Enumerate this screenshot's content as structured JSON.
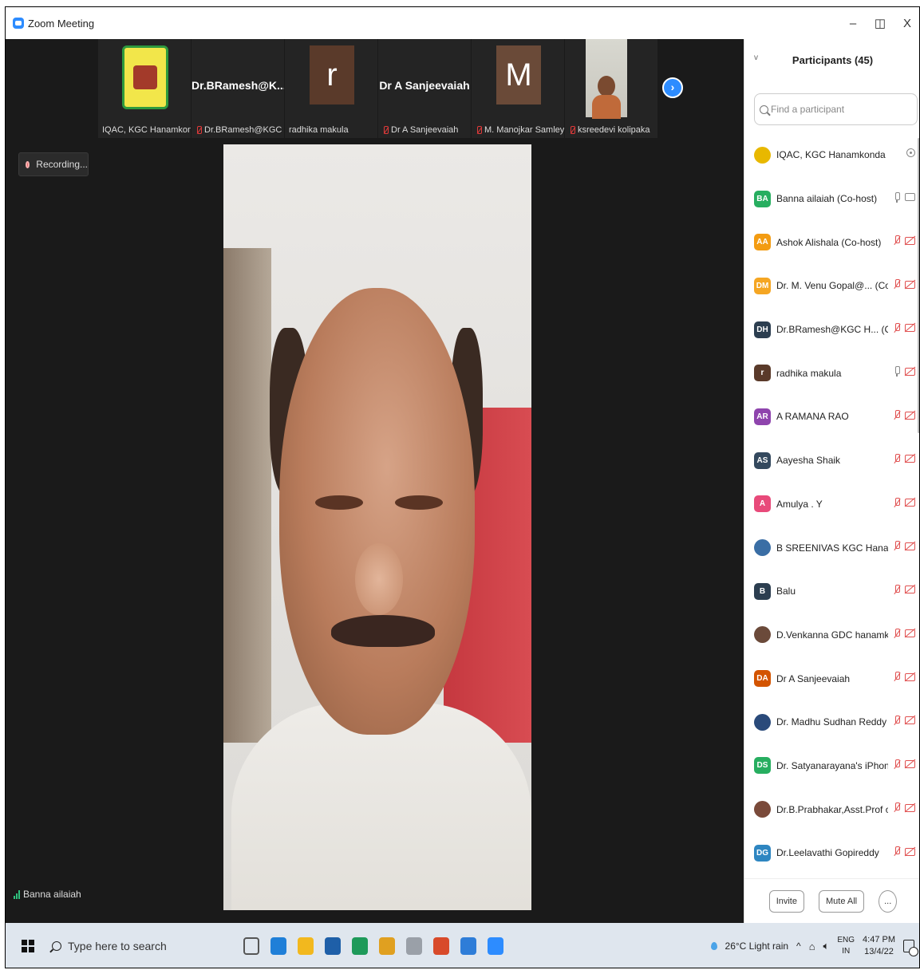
{
  "window": {
    "title": "Zoom Meeting",
    "minimize": "–",
    "maximize": "◫",
    "close": "X"
  },
  "strip": {
    "tiles": [
      {
        "name": "IQAC, KGC Hanamkonda",
        "kind": "logo",
        "muted": false
      },
      {
        "name": "Dr.BRamesh@KGC H...",
        "display": "Dr.BRamesh@K...",
        "kind": "text",
        "muted": true
      },
      {
        "name": "radhika makula",
        "letter": "r",
        "kind": "letter",
        "muted": false
      },
      {
        "name": "Dr A Sanjeevaiah",
        "display": "Dr A Sanjeevaiah",
        "kind": "text",
        "muted": true
      },
      {
        "name": "M. Manojkar Samley, ...",
        "letter": "M",
        "kind": "letter",
        "muted": true
      },
      {
        "name": "ksreedevi kolipaka",
        "kind": "photo",
        "muted": true
      }
    ],
    "next": "›"
  },
  "recording": {
    "label": "Recording..."
  },
  "speaker": {
    "name": "Banna ailaiah"
  },
  "participants": {
    "title": "Participants (45)",
    "collapse": "v",
    "search_placeholder": "Find a participant",
    "list": [
      {
        "initials": "",
        "color": "#e8b800",
        "name": "IQAC, KGC Hanamkonda (Host, me)",
        "mic": "none",
        "cam": "dot"
      },
      {
        "initials": "BA",
        "color": "#27ae60",
        "name": "Banna ailaiah (Co-host)",
        "mic": "on",
        "cam": "on"
      },
      {
        "initials": "AA",
        "color": "#f39c12",
        "name": "Ashok Alishala (Co-host)",
        "mic": "off",
        "cam": "off"
      },
      {
        "initials": "DM",
        "color": "#f5a623",
        "name": "Dr. M. Venu Gopal@... (Co-host)",
        "mic": "off",
        "cam": "off"
      },
      {
        "initials": "DH",
        "color": "#2c3e50",
        "name": "Dr.BRamesh@KGC H... (Co-host)",
        "mic": "off",
        "cam": "off"
      },
      {
        "initials": "r",
        "color": "#5a3a2a",
        "name": "radhika makula",
        "mic": "on",
        "cam": "off"
      },
      {
        "initials": "AR",
        "color": "#8e44ad",
        "name": "A RAMANA RAO",
        "mic": "off",
        "cam": "off"
      },
      {
        "initials": "AS",
        "color": "#34495e",
        "name": "Aayesha Shaik",
        "mic": "off",
        "cam": "off"
      },
      {
        "initials": "A",
        "color": "#e84a7a",
        "name": "Amulya . Y",
        "mic": "off",
        "cam": "off"
      },
      {
        "initials": "",
        "color": "#3a6ea5",
        "name": "B SREENIVAS KGC Hanamkonda",
        "mic": "off",
        "cam": "off"
      },
      {
        "initials": "B",
        "color": "#2c3e50",
        "name": "Balu",
        "mic": "off",
        "cam": "off"
      },
      {
        "initials": "",
        "color": "#6b4a3a",
        "name": "D.Venkanna GDC hanamkonda ...",
        "mic": "off",
        "cam": "off"
      },
      {
        "initials": "DA",
        "color": "#d35400",
        "name": "Dr A Sanjeevaiah",
        "mic": "off",
        "cam": "off"
      },
      {
        "initials": "",
        "color": "#2a4a7a",
        "name": "Dr. Madhu Sudhan Reddy And...",
        "mic": "off",
        "cam": "off"
      },
      {
        "initials": "DS",
        "color": "#27ae60",
        "name": "Dr. Satyanarayana's iPhone",
        "mic": "off",
        "cam": "off"
      },
      {
        "initials": "",
        "color": "#7a4a3a",
        "name": "Dr.B.Prabhakar,Asst.Prof of Ma...",
        "mic": "off",
        "cam": "off"
      },
      {
        "initials": "DG",
        "color": "#2e86c1",
        "name": "Dr.Leelavathi Gopireddy",
        "mic": "off",
        "cam": "off"
      }
    ],
    "invite": "Invite",
    "mute_all": "Mute All",
    "more": "..."
  },
  "taskbar": {
    "search_placeholder": "Type here to search",
    "weather": "26°C  Light rain",
    "tray_chevron": "^",
    "lang_top": "ENG",
    "lang_bottom": "IN",
    "time": "4:47 PM",
    "date": "13/4/22",
    "apps": [
      {
        "icon": "task-view-icon",
        "color": "#555"
      },
      {
        "icon": "edge-icon",
        "color": "#1f7fd8"
      },
      {
        "icon": "file-explorer-icon",
        "color": "#f2b81e"
      },
      {
        "icon": "mail-icon",
        "color": "#1e5fa8"
      },
      {
        "icon": "security-icon",
        "color": "#1e9a5a"
      },
      {
        "icon": "chrome-icon",
        "color": "#e0a020"
      },
      {
        "icon": "paint-icon",
        "color": "#9aa0a8"
      },
      {
        "icon": "google-icon",
        "color": "#d84a2a"
      },
      {
        "icon": "notepad-icon",
        "color": "#2e7dd8"
      },
      {
        "icon": "zoom-icon",
        "color": "#2d8cff"
      }
    ]
  }
}
